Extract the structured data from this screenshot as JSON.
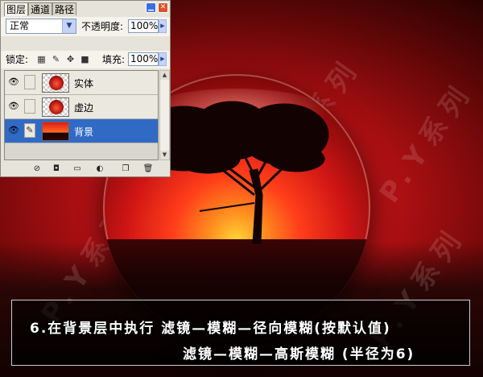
{
  "palette": {
    "tabs": [
      "图层",
      "通道",
      "路径"
    ],
    "blend_mode": "正常",
    "opacity_label": "不透明度:",
    "opacity_value": "100%",
    "lock_label": "锁定:",
    "fill_label": "填充:",
    "fill_value": "100%",
    "layers": [
      {
        "name": "实体",
        "visible": true,
        "selected": false
      },
      {
        "name": "虚边",
        "visible": true,
        "selected": false
      },
      {
        "name": "背景",
        "visible": true,
        "selected": true
      }
    ],
    "accent_color": "#316ac5"
  },
  "caption": {
    "line1": "6.在背景层中执行 滤镜—模糊—径向模糊(按默认值)",
    "line2": "滤镜—模糊—高斯模糊 (半径为6)"
  },
  "watermark": "P.Y系列"
}
